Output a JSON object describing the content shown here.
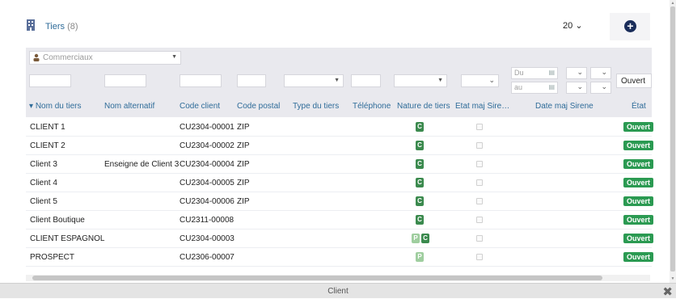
{
  "header": {
    "title": "Tiers",
    "count": "(8)",
    "page_size": "20",
    "page_size_caret": "⌄",
    "add_icon": "+"
  },
  "filters": {
    "commerciaux_placeholder": "Commerciaux",
    "date_du": "Du",
    "date_au": "au",
    "etat_value": "Ouvert"
  },
  "columns": [
    "Nom du tiers",
    "Nom alternatif",
    "Code client",
    "Code postal",
    "Type du tiers",
    "Téléphone",
    "Nature de tiers",
    "Etat maj Sire…",
    "Date maj Sirene",
    "État"
  ],
  "sort_indicator": "▾",
  "rows": [
    {
      "nom": "CLIENT 1",
      "alt": "",
      "code": "CU2304-00001",
      "cp": "ZIP",
      "nature": [
        "C"
      ],
      "etat": "Ouvert"
    },
    {
      "nom": "CLIENT 2",
      "alt": "",
      "code": "CU2304-00002",
      "cp": "ZIP",
      "nature": [
        "C"
      ],
      "etat": "Ouvert"
    },
    {
      "nom": "Client 3",
      "alt": "Enseigne de Client 3",
      "code": "CU2304-00004",
      "cp": "ZIP",
      "nature": [
        "C"
      ],
      "etat": "Ouvert"
    },
    {
      "nom": "Client 4",
      "alt": "",
      "code": "CU2304-00005",
      "cp": "ZIP",
      "nature": [
        "C"
      ],
      "etat": "Ouvert"
    },
    {
      "nom": "Client 5",
      "alt": "",
      "code": "CU2304-00006",
      "cp": "ZIP",
      "nature": [
        "C"
      ],
      "etat": "Ouvert"
    },
    {
      "nom": "Client Boutique",
      "alt": "",
      "code": "CU2311-00008",
      "cp": "",
      "nature": [
        "C"
      ],
      "etat": "Ouvert"
    },
    {
      "nom": "CLIENT ESPAGNOL",
      "alt": "",
      "code": "CU2304-00003",
      "cp": "",
      "nature": [
        "P",
        "C"
      ],
      "etat": "Ouvert"
    },
    {
      "nom": "PROSPECT",
      "alt": "",
      "code": "CU2306-00007",
      "cp": "",
      "nature": [
        "P"
      ],
      "etat": "Ouvert"
    }
  ],
  "footer": {
    "label": "Client",
    "close_icon": "✖"
  },
  "colors": {
    "accent": "#2f6c99",
    "status_green": "#2b9a52",
    "badge_c": "#3b8a4e",
    "badge_p": "#9fce9f",
    "filter_bg": "#e9e9ee"
  }
}
